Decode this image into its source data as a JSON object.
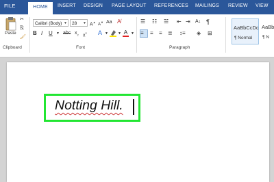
{
  "tabs": [
    {
      "label": "FILE",
      "active": false
    },
    {
      "label": "HOME",
      "active": true
    },
    {
      "label": "INSERT",
      "active": false
    },
    {
      "label": "DESIGN",
      "active": false
    },
    {
      "label": "PAGE LAYOUT",
      "active": false
    },
    {
      "label": "REFERENCES",
      "active": false
    },
    {
      "label": "MAILINGS",
      "active": false
    },
    {
      "label": "REVIEW",
      "active": false
    },
    {
      "label": "VIEW",
      "active": false
    }
  ],
  "clipboard": {
    "paste_label": "Paste",
    "group_label": "Clipboard"
  },
  "font": {
    "name": "Calibri (Body)",
    "size": "28",
    "group_label": "Font"
  },
  "paragraph": {
    "group_label": "Paragraph"
  },
  "styles": [
    {
      "sample": "AaBbCcDc",
      "name": "¶ Normal"
    },
    {
      "sample": "AaBb",
      "name": "¶ N"
    }
  ],
  "document": {
    "text": "Notting Hill."
  },
  "colors": {
    "accent": "#2b579a",
    "highlight_box": "#22e632"
  }
}
